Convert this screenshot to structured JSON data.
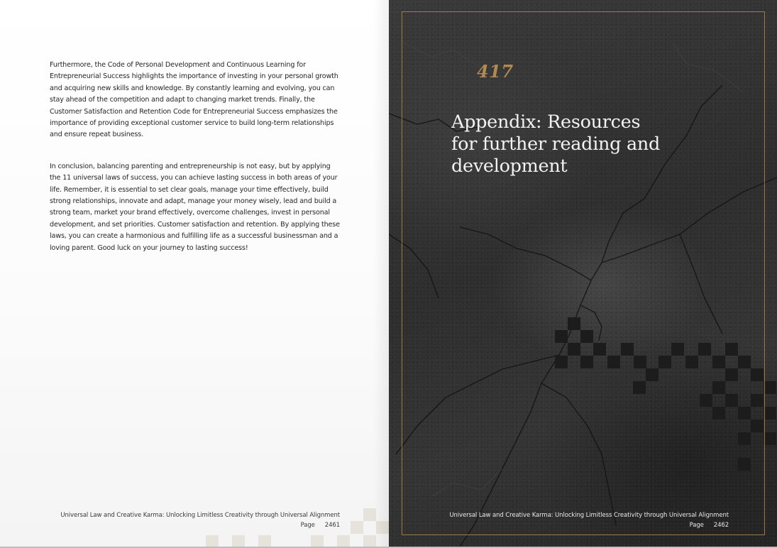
{
  "left_page": {
    "paragraphs": [
      "Furthermore, the Code of Personal Development and Continuous Learning for Entrepreneurial Success highlights the importance of investing in your personal growth and acquiring new skills and knowledge. By constantly learning and evolving, you can stay ahead of the competition and adapt to changing market trends. Finally, the Customer Satisfaction and Retention Code for Entrepreneurial Success emphasizes the importance of providing exceptional customer service to build long-term relationships and ensure repeat business.",
      "In conclusion, balancing parenting and entrepreneurship is not easy, but by applying the 11 universal laws of success, you can achieve lasting success in both areas of your life. Remember, it is essential to set clear goals, manage your time effectively, build strong relationships, innovate and adapt, manage your money wisely, lead and build a strong team, market your brand effectively, overcome challenges, invest in personal development, and set priorities. Customer satisfaction and retention. By applying these laws, you can create a harmonious and fulfilling life as a successful businessman and a loving parent. Good luck on your journey to lasting success!"
    ],
    "footer": {
      "book_title": "Universal Law and Creative Karma: Unlocking Limitless Creativity through Universal Alignment",
      "page_label": "Page",
      "page_number": "2461"
    }
  },
  "right_page": {
    "chapter_number": "417",
    "chapter_title": "Appendix: Resources for further reading and development",
    "footer": {
      "book_title": "Universal Law and Creative Karma: Unlocking Limitless Creativity through Universal Alignment",
      "page_label": "Page",
      "page_number": "2462"
    }
  },
  "colors": {
    "accent_gold": "#b08a52",
    "frame_gold": "#9a7a46",
    "dark_background": "#2e2e2e"
  }
}
